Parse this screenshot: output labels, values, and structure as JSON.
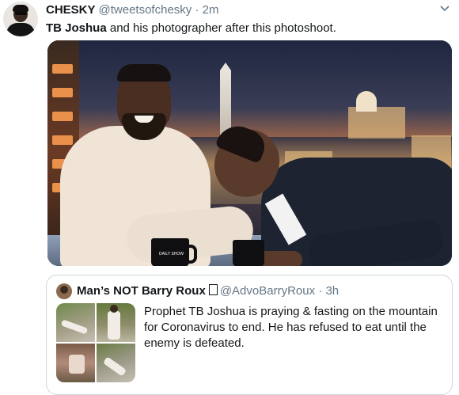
{
  "tweet": {
    "name": "CHESKY",
    "handle": "@tweetsofchesky",
    "separator": "·",
    "time": "2m",
    "caret": "⌄",
    "text_bold": "TB Joshua",
    "text_rest": " and his photographer after this photoshoot."
  },
  "photo": {
    "mug_text": "DAILY SHOW"
  },
  "quoted_tweet": {
    "name": "Man’s NOT Barry Roux",
    "handle": "@AdvoBarryRoux",
    "separator": "·",
    "time": "3h",
    "text": "Prophet TB Joshua is praying & fasting on the mountain for Coronavirus to end. He has refused to eat until the enemy is defeated."
  },
  "colors": {
    "text_primary": "#14171a",
    "text_secondary": "#657786",
    "border": "#ccd6dd"
  }
}
